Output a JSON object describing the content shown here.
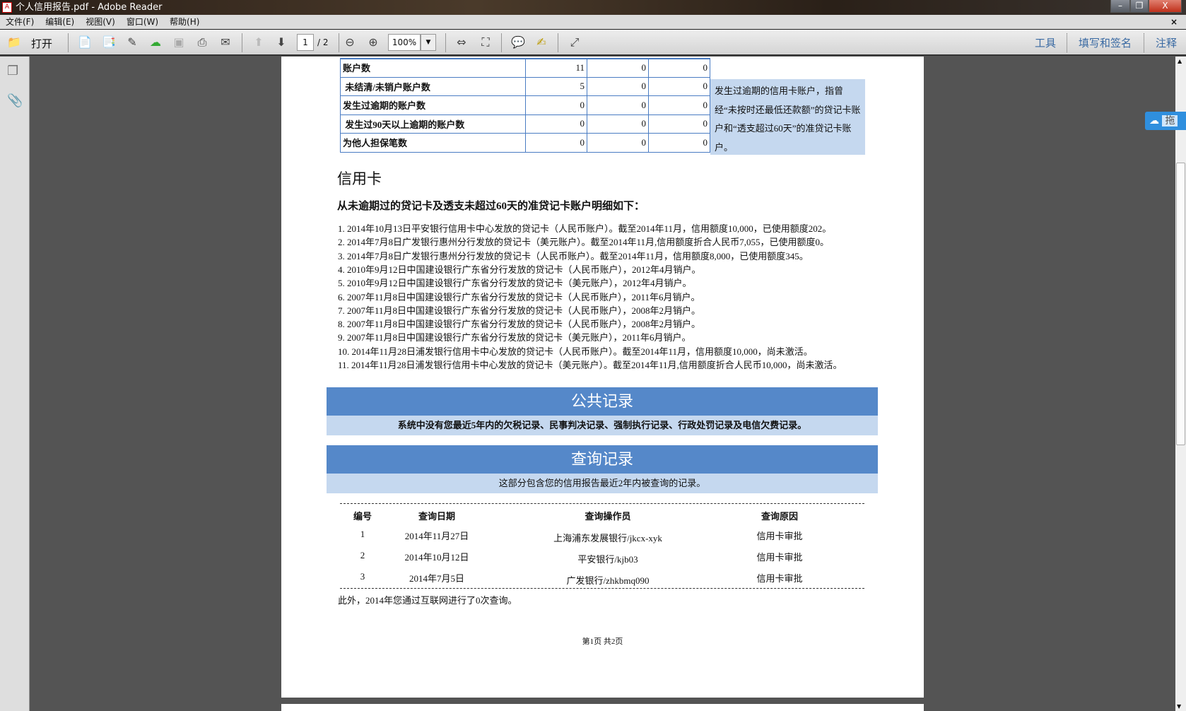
{
  "window": {
    "title": "个人信用报告.pdf - Adobe Reader",
    "minimize": "–",
    "restore": "❐",
    "close": "X"
  },
  "menu": [
    "文件(F)",
    "编辑(E)",
    "视图(V)",
    "窗口(W)",
    "帮助(H)"
  ],
  "menu_close": "×",
  "toolbar": {
    "open": "打开",
    "page_current": "1",
    "page_total": "/ 2",
    "zoom": "100%",
    "tools": "工具",
    "fill_sign": "填写和签名",
    "comment": "注释"
  },
  "summary_table": {
    "rows": [
      {
        "label": "账户数",
        "values": [
          "11",
          "0",
          "0"
        ]
      },
      {
        "label": " 未结清/未销户账户数",
        "values": [
          "5",
          "0",
          "0"
        ]
      },
      {
        "label": "发生过逾期的账户数",
        "values": [
          "0",
          "0",
          "0"
        ]
      },
      {
        "label": " 发生过90天以上逾期的账户数",
        "values": [
          "0",
          "0",
          "0"
        ]
      },
      {
        "label": "为他人担保笔数",
        "values": [
          "0",
          "0",
          "0"
        ]
      }
    ],
    "note": "发生过逾期的信用卡账户，指曾经“未按时还最低还款额”的贷记卡账户和“透支超过60天”的准贷记卡账户。"
  },
  "credit_card": {
    "heading": "信用卡",
    "subheading": "从未逾期过的贷记卡及透支未超过60天的准贷记卡账户明细如下：",
    "items": [
      "1.  2014年10月13日平安银行信用卡中心发放的贷记卡（人民币账户）。截至2014年11月，信用额度10,000，已使用额度202。",
      "2.  2014年7月8日广发银行惠州分行发放的贷记卡（美元账户）。截至2014年11月,信用额度折合人民币7,055，已使用额度0。",
      "3.  2014年7月8日广发银行惠州分行发放的贷记卡（人民币账户）。截至2014年11月，信用额度8,000，已使用额度345。",
      "4.  2010年9月12日中国建设银行广东省分行发放的贷记卡（人民币账户），2012年4月销户。",
      "5.  2010年9月12日中国建设银行广东省分行发放的贷记卡（美元账户），2012年4月销户。",
      "6.  2007年11月8日中国建设银行广东省分行发放的贷记卡（人民币账户），2011年6月销户。",
      "7.  2007年11月8日中国建设银行广东省分行发放的贷记卡（人民币账户），2008年2月销户。",
      "8.  2007年11月8日中国建设银行广东省分行发放的贷记卡（人民币账户），2008年2月销户。",
      "9.  2007年11月8日中国建设银行广东省分行发放的贷记卡（美元账户），2011年6月销户。",
      "10. 2014年11月28日浦发银行信用卡中心发放的贷记卡（人民币账户）。截至2014年11月，信用额度10,000，尚未激活。",
      "11. 2014年11月28日浦发银行信用卡中心发放的贷记卡（美元账户）。截至2014年11月,信用额度折合人民币10,000，尚未激活。"
    ]
  },
  "public_records": {
    "title": "公共记录",
    "text": "系统中没有您最近5年内的欠税记录、民事判决记录、强制执行记录、行政处罚记录及电信欠费记录。"
  },
  "query_records": {
    "title": "查询记录",
    "text": "这部分包含您的信用报告最近2年内被查询的记录。",
    "headers": [
      "编号",
      "查询日期",
      "查询操作员",
      "查询原因"
    ],
    "rows": [
      [
        "1",
        "2014年11月27日",
        "上海浦东发展银行/jkcx-xyk",
        "信用卡审批"
      ],
      [
        "2",
        "2014年10月12日",
        "平安银行/kjb03",
        "信用卡审批"
      ],
      [
        "3",
        "2014年7月5日",
        "广发银行/zhkbmq090",
        "信用卡审批"
      ]
    ],
    "footnote": "此外，2014年您通过互联网进行了0次查询。"
  },
  "page_footer": "第1页  共2页",
  "side_widget": "拖"
}
